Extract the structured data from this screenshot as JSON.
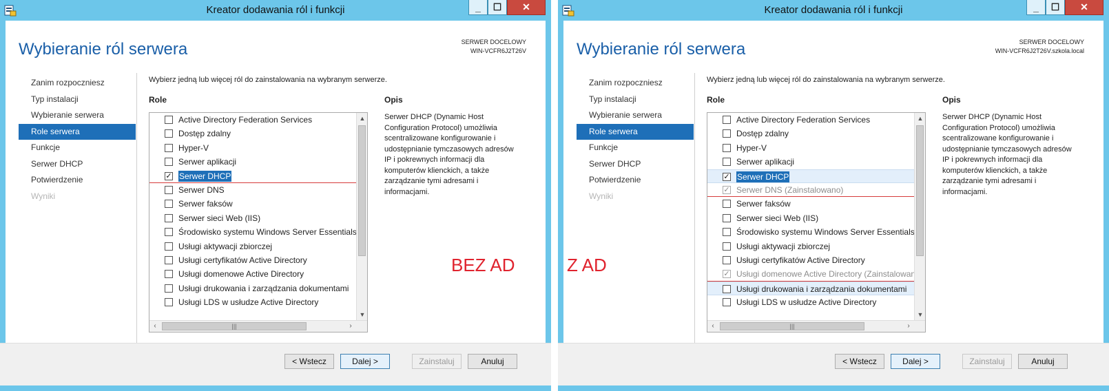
{
  "windows": [
    {
      "title": "Kreator dodawania ról i funkcji",
      "page_title": "Wybieranie ról serwera",
      "destination_label": "SERWER DOCELOWY",
      "destination_server": "WIN-VCFR6J2T26V",
      "nav": [
        {
          "label": "Zanim rozpoczniesz",
          "state": "normal"
        },
        {
          "label": "Typ instalacji",
          "state": "normal"
        },
        {
          "label": "Wybieranie serwera",
          "state": "normal"
        },
        {
          "label": "Role serwera",
          "state": "active"
        },
        {
          "label": "Funkcje",
          "state": "normal"
        },
        {
          "label": "Serwer DHCP",
          "state": "normal"
        },
        {
          "label": "Potwierdzenie",
          "state": "normal"
        },
        {
          "label": "Wyniki",
          "state": "disabled"
        }
      ],
      "instruction": "Wybierz jedną lub więcej ról do zainstalowania na wybranym serwerze.",
      "roles_header": "Role",
      "description_header": "Opis",
      "roles": [
        {
          "label": "Active Directory Federation Services",
          "checked": false,
          "installed": false
        },
        {
          "label": "Dostęp zdalny",
          "checked": false,
          "installed": false
        },
        {
          "label": "Hyper-V",
          "checked": false,
          "installed": false
        },
        {
          "label": "Serwer aplikacji",
          "checked": false,
          "installed": false
        },
        {
          "label": "Serwer DHCP",
          "checked": true,
          "installed": false,
          "selected": true,
          "red_line": true
        },
        {
          "label": "Serwer DNS",
          "checked": false,
          "installed": false
        },
        {
          "label": "Serwer faksów",
          "checked": false,
          "installed": false
        },
        {
          "label": "Serwer sieci Web (IIS)",
          "checked": false,
          "installed": false
        },
        {
          "label": "Środowisko systemu Windows Server Essentials",
          "checked": false,
          "installed": false
        },
        {
          "label": "Usługi aktywacji zbiorczej",
          "checked": false,
          "installed": false
        },
        {
          "label": "Usługi certyfikatów Active Directory",
          "checked": false,
          "installed": false
        },
        {
          "label": "Usługi domenowe Active Directory",
          "checked": false,
          "installed": false
        },
        {
          "label": "Usługi drukowania i zarządzania dokumentami",
          "checked": false,
          "installed": false
        },
        {
          "label": "Usługi LDS w usłudze Active Directory",
          "checked": false,
          "installed": false
        }
      ],
      "description": "Serwer DHCP (Dynamic Host Configuration Protocol) umożliwia scentralizowane konfigurowanie i udostępnianie tymczasowych adresów IP i pokrewnych informacji dla komputerów klienckich, a także zarządzanie tymi adresami i informacjami.",
      "annotation": "BEZ AD",
      "buttons": {
        "back": "< Wstecz",
        "next": "Dalej >",
        "install": "Zainstaluj",
        "cancel": "Anuluj"
      }
    },
    {
      "title": "Kreator dodawania ról i funkcji",
      "page_title": "Wybieranie ról serwera",
      "destination_label": "SERWER DOCELOWY",
      "destination_server": "WIN-VCFR6J2T26V.szkola.local",
      "nav": [
        {
          "label": "Zanim rozpoczniesz",
          "state": "normal"
        },
        {
          "label": "Typ instalacji",
          "state": "normal"
        },
        {
          "label": "Wybieranie serwera",
          "state": "normal"
        },
        {
          "label": "Role serwera",
          "state": "active"
        },
        {
          "label": "Funkcje",
          "state": "normal"
        },
        {
          "label": "Serwer DHCP",
          "state": "normal"
        },
        {
          "label": "Potwierdzenie",
          "state": "normal"
        },
        {
          "label": "Wyniki",
          "state": "disabled"
        }
      ],
      "instruction": "Wybierz jedną lub więcej ról do zainstalowania na wybranym serwerze.",
      "roles_header": "Role",
      "description_header": "Opis",
      "roles": [
        {
          "label": "Active Directory Federation Services",
          "checked": false,
          "installed": false
        },
        {
          "label": "Dostęp zdalny",
          "checked": false,
          "installed": false
        },
        {
          "label": "Hyper-V",
          "checked": false,
          "installed": false
        },
        {
          "label": "Serwer aplikacji",
          "checked": false,
          "installed": false
        },
        {
          "label": "Serwer DHCP",
          "checked": true,
          "installed": false,
          "selected": true,
          "highlight": true
        },
        {
          "label": "Serwer DNS (Zainstalowano)",
          "checked": true,
          "installed": true,
          "red_line": true
        },
        {
          "label": "Serwer faksów",
          "checked": false,
          "installed": false
        },
        {
          "label": "Serwer sieci Web (IIS)",
          "checked": false,
          "installed": false
        },
        {
          "label": "Środowisko systemu Windows Server Essentials",
          "checked": false,
          "installed": false
        },
        {
          "label": "Usługi aktywacji zbiorczej",
          "checked": false,
          "installed": false
        },
        {
          "label": "Usługi certyfikatów Active Directory",
          "checked": false,
          "installed": false
        },
        {
          "label": "Usługi domenowe Active Directory (Zainstalowano)",
          "checked": true,
          "installed": true,
          "red_line": true
        },
        {
          "label": "Usługi drukowania i zarządzania dokumentami",
          "checked": false,
          "installed": false,
          "highlight": true
        },
        {
          "label": "Usługi LDS w usłudze Active Directory",
          "checked": false,
          "installed": false
        }
      ],
      "description": "Serwer DHCP (Dynamic Host Configuration Protocol) umożliwia scentralizowane konfigurowanie i udostępnianie tymczasowych adresów IP i pokrewnych informacji dla komputerów klienckich, a także zarządzanie tymi adresami i informacjami.",
      "annotation": "Z AD",
      "buttons": {
        "back": "< Wstecz",
        "next": "Dalej >",
        "install": "Zainstaluj",
        "cancel": "Anuluj"
      }
    }
  ]
}
